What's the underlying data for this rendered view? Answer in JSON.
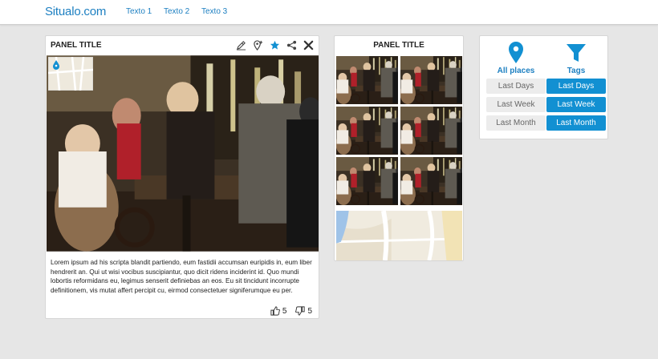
{
  "topbar": {
    "brand": "Situalo.com",
    "nav": [
      "Texto 1",
      "Texto 2",
      "Texto 3"
    ]
  },
  "panel_main": {
    "title": "PANEL TITLE",
    "tools": [
      "edit-icon",
      "add-place-icon",
      "star-icon",
      "share-icon",
      "close-icon"
    ],
    "description": "Lorem ipsum ad his scripta blandit partiendo, eum fastidii accumsan euripidis in, eum liber hendrerit an. Qui ut wisi vocibus suscipiantur, quo dicit ridens inciderint id. Quo mundi lobortis reformidans eu, legimus senserit definiebas an eos. Eu sit tincidunt incorrupte definitionem, vis mutat affert percipit cu, eirmod consectetuer signiferumque eu per.",
    "likes": "5",
    "dislikes": "5"
  },
  "panel_gallery": {
    "title": "PANEL TITLE"
  },
  "panel_filters": {
    "places_label": "All places",
    "tags_label": "Tags",
    "places_options": [
      "Last Days",
      "Last Week",
      "Last Month"
    ],
    "tags_options": [
      "Last Days",
      "Last Week",
      "Last Month"
    ]
  },
  "colors": {
    "accent": "#1290d2",
    "brand": "#1c7fc1",
    "background": "#e6e6e6"
  }
}
